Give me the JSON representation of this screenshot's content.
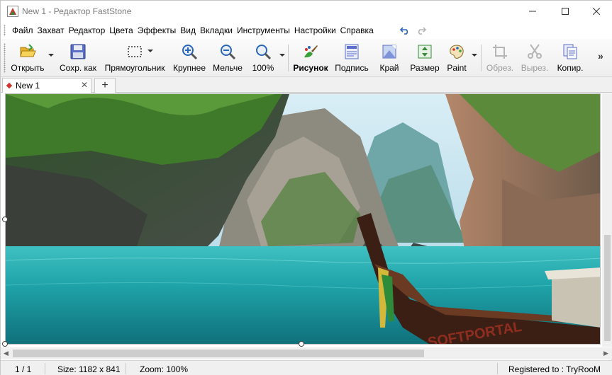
{
  "window": {
    "title": "New 1 - Редактор FastStone"
  },
  "menu": {
    "items": [
      "Файл",
      "Захват",
      "Редактор",
      "Цвета",
      "Эффекты",
      "Вид",
      "Вкладки",
      "Инструменты",
      "Настройки",
      "Справка"
    ]
  },
  "toolbar": {
    "open": "Открыть",
    "save_as": "Сохр. как",
    "rectangle": "Прямоугольник",
    "zoom_in": "Крупнее",
    "zoom_out": "Мельче",
    "zoom_level": "100%",
    "draw": "Рисунок",
    "caption": "Подпись",
    "edge": "Край",
    "resize": "Размер",
    "paint": "Paint",
    "crop": "Обрез.",
    "cut": "Вырез.",
    "copy": "Копир."
  },
  "tabs": {
    "active_label": "New 1",
    "close": "✕",
    "add": "+"
  },
  "image": {
    "watermark": "SOFTPORTAL"
  },
  "status": {
    "page": "1 / 1",
    "size": "Size: 1182 x 841",
    "zoom": "Zoom: 100%",
    "registered": "Registered to : TryRooM"
  },
  "colors": {
    "accent": "#2a66b8",
    "water": "#1fa3a8",
    "cliff": "#8c7d6e",
    "foliage": "#3f7a2a"
  }
}
